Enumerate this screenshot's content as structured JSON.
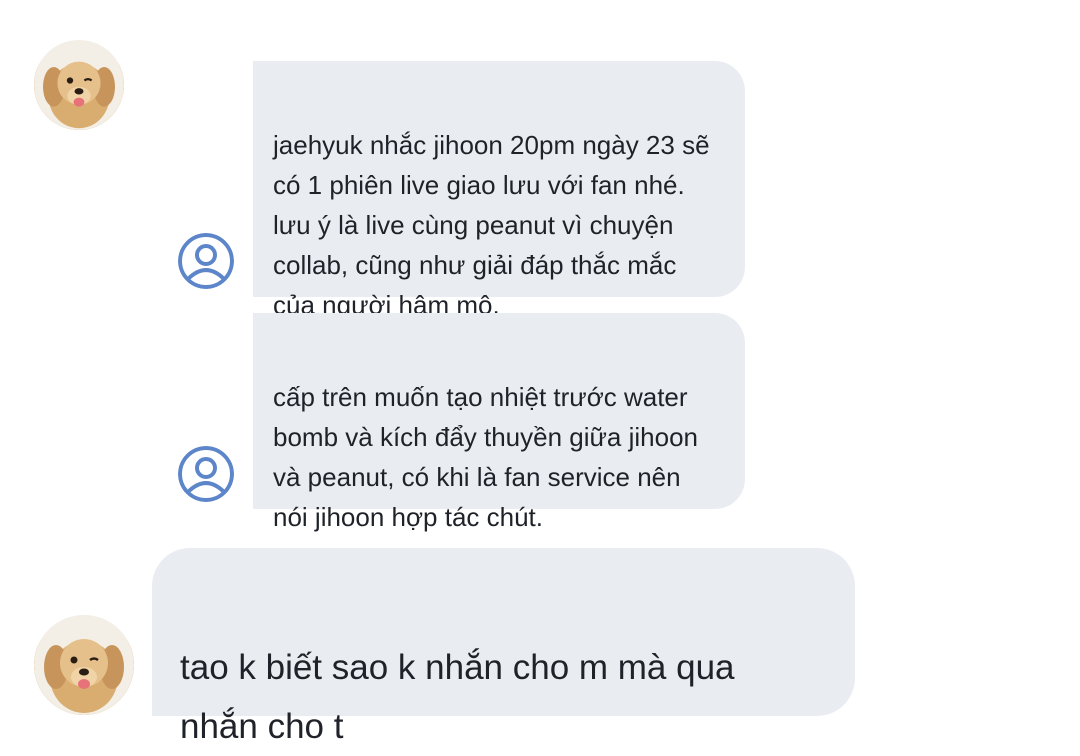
{
  "conversation": {
    "messages": [
      {
        "sender": "dog",
        "text": "jaehyuk nhắc jihoon 20pm ngày 23 sẽ\ncó 1 phiên live giao lưu với fan nhé.\nlưu ý là live cùng peanut vì chuyện\ncollab, cũng như giải đáp thắc mắc\ncủa người hâm mộ."
      },
      {
        "sender": "dog",
        "text": "cấp trên muốn tạo nhiệt trước water\nbomb và kích đẩy thuyền giữa jihoon\nvà peanut, có khi là fan service nên\nnói jihoon hợp tác chút."
      },
      {
        "sender": "dog",
        "text": "tao k biết sao k nhắn cho m mà qua\nnhắn cho t"
      }
    ]
  },
  "colors": {
    "bubble_background": "#e9edf2",
    "text": "#1f2329",
    "user_avatar_ring": "#5c86c9"
  },
  "icons": {
    "sender_avatar": "golden-retriever-puppy-photo",
    "quoted_avatar": "default-user-icon"
  }
}
